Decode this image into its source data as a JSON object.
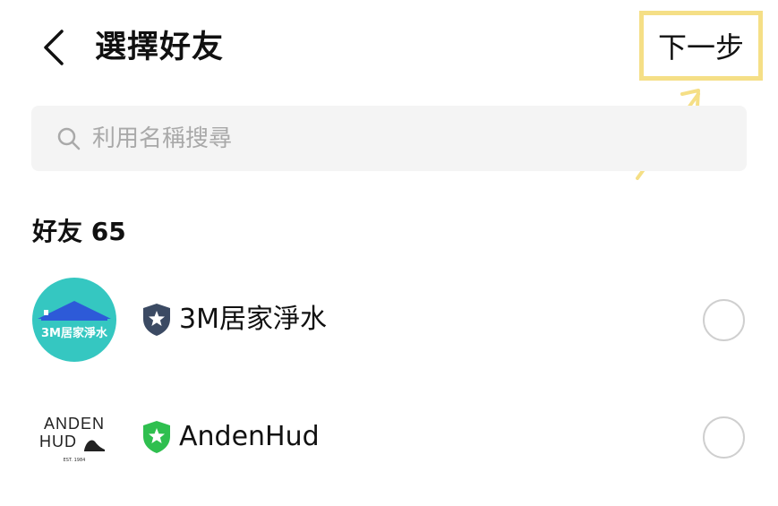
{
  "header": {
    "title": "選擇好友",
    "next_label": "下一步"
  },
  "search": {
    "placeholder": "利用名稱搜尋"
  },
  "friends": {
    "section_title": "好友 65",
    "items": [
      {
        "name": "3M居家淨水",
        "avatar_text": "3M居家淨水",
        "badge": "shield-star-icon",
        "badge_color": "#3b4a63",
        "avatar_color": "#35c7c1"
      },
      {
        "name": "AndenHud",
        "avatar_line1": "ANDEN",
        "avatar_line2": "HUD",
        "avatar_est": "EST. 1984",
        "badge": "shield-star-icon",
        "badge_color": "#2fbf4f"
      }
    ]
  },
  "colors": {
    "highlight_border": "#f5df86",
    "search_bg": "#f4f4f4"
  }
}
